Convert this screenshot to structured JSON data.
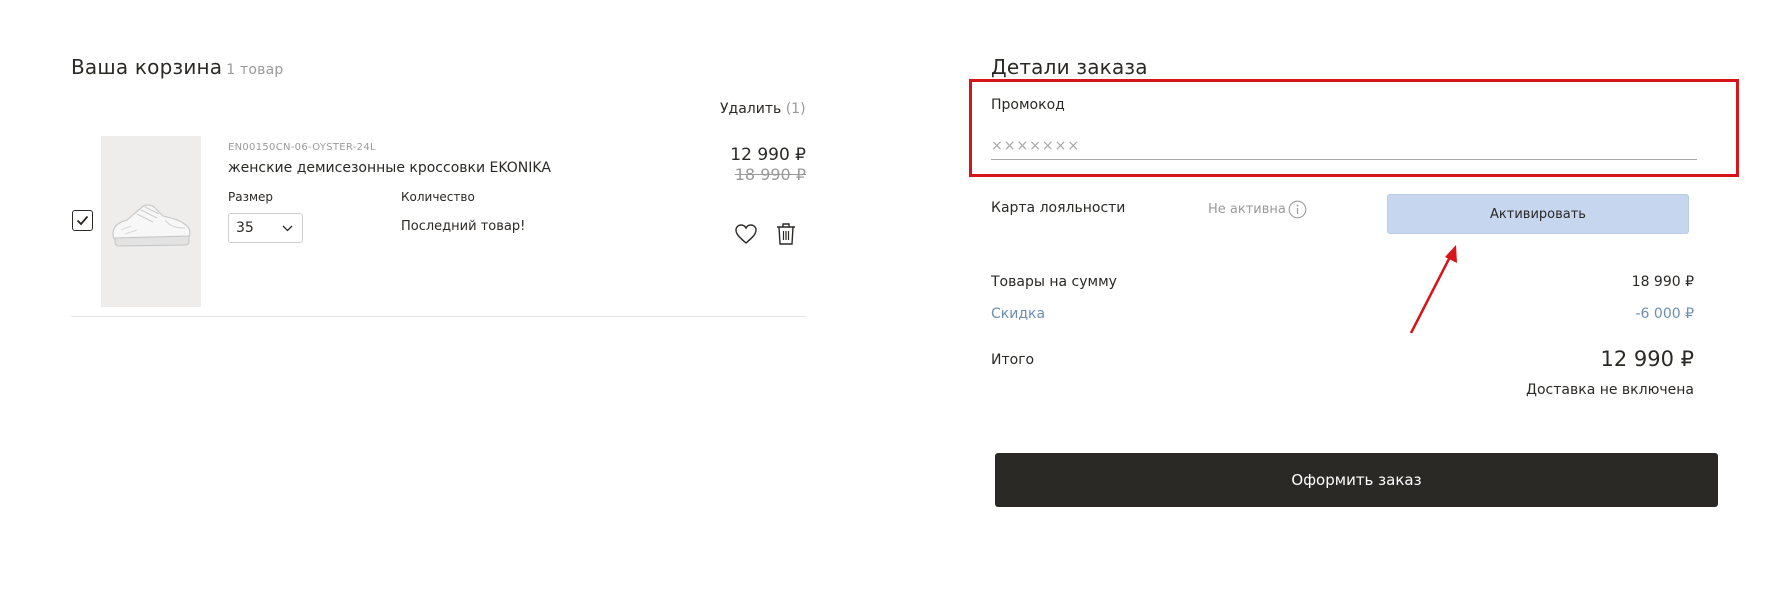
{
  "cart": {
    "title": "Ваша корзина",
    "count": "1 товар",
    "delete_all_label": "Удалить",
    "delete_all_count": "(1)",
    "item": {
      "checked": true,
      "sku": "EN00150CN-06-OYSTER-24L",
      "name": "женские демисезонные кроссовки EKONIKA",
      "size_label": "Размер",
      "size_value": "35",
      "quantity_label": "Количество",
      "quantity_note": "Последний товар!",
      "price_current": "12 990 ₽",
      "price_old": "18 990 ₽",
      "icons": [
        "heart-icon",
        "trash-icon",
        "check-icon",
        "chevron-down-icon"
      ]
    }
  },
  "order": {
    "title": "Детали заказа",
    "promo_label": "Промокод",
    "promo_placeholder": "×××××××",
    "loyalty_label": "Карта лояльности",
    "loyalty_status": "Не активна",
    "activate_label": "Активировать",
    "goods_sum_label": "Товары на сумму",
    "goods_sum_value": "18 990 ₽",
    "discount_label": "Скидка",
    "discount_value": "-6 000 ₽",
    "total_label": "Итого",
    "total_value": "12 990 ₽",
    "delivery_note": "Доставка не включена",
    "checkout_label": "Оформить заказ"
  },
  "annotation": {
    "highlight_color": "#d7141a",
    "arrow_color": "#d7141a"
  },
  "colors": {
    "text": "#2b2926",
    "muted": "#9a9a9a",
    "discount": "#6a8fb3",
    "activate_bg": "#c5d6ee",
    "checkout_bg": "#2b2926"
  }
}
